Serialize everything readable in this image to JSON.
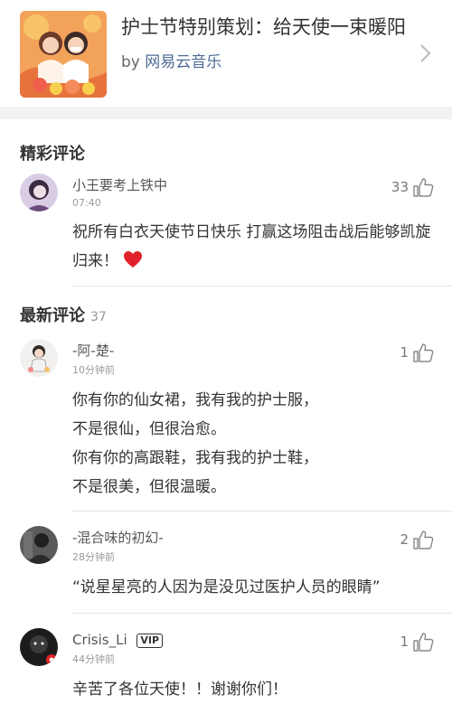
{
  "playlist": {
    "title": "护士节特别策划：给天使一束暖阳",
    "by_prefix": "by",
    "creator": "网易云音乐"
  },
  "hot_section": {
    "title": "精彩评论"
  },
  "latest_section": {
    "title": "最新评论",
    "count": "37"
  },
  "hot_comments": [
    {
      "user": "小王要考上铁中",
      "time": "07:40",
      "likes": "33",
      "text": "祝所有白衣天使节日快乐 打赢这场阻击战后能够凯旋归来！",
      "emoji": "heart-icon"
    }
  ],
  "latest_comments": [
    {
      "user": "-阿-楚-",
      "time": "10分钟前",
      "likes": "1",
      "lines": [
        "你有你的仙女裙，我有我的护士服，",
        "不是很仙，但很治愈。",
        "你有你的高跟鞋，我有我的护士鞋，",
        "不是很美，但很温暖。"
      ]
    },
    {
      "user": "-混合味的初幻-",
      "time": "28分钟前",
      "likes": "2",
      "text": "“说星星亮的人因为是没见过医护人员的眼睛”"
    },
    {
      "user": "Crisis_Li",
      "badge": "VIP",
      "time": "44分钟前",
      "likes": "1",
      "text": "辛苦了各位天使！！谢谢你们！"
    }
  ],
  "icons": {
    "like": "thumbs-up-icon",
    "chevron": "chevron-right-icon"
  },
  "colors": {
    "creator_link": "#4e6b94",
    "heart": "#e0232b",
    "divider": "#e6e6e6",
    "band": "#f2f2f2"
  }
}
